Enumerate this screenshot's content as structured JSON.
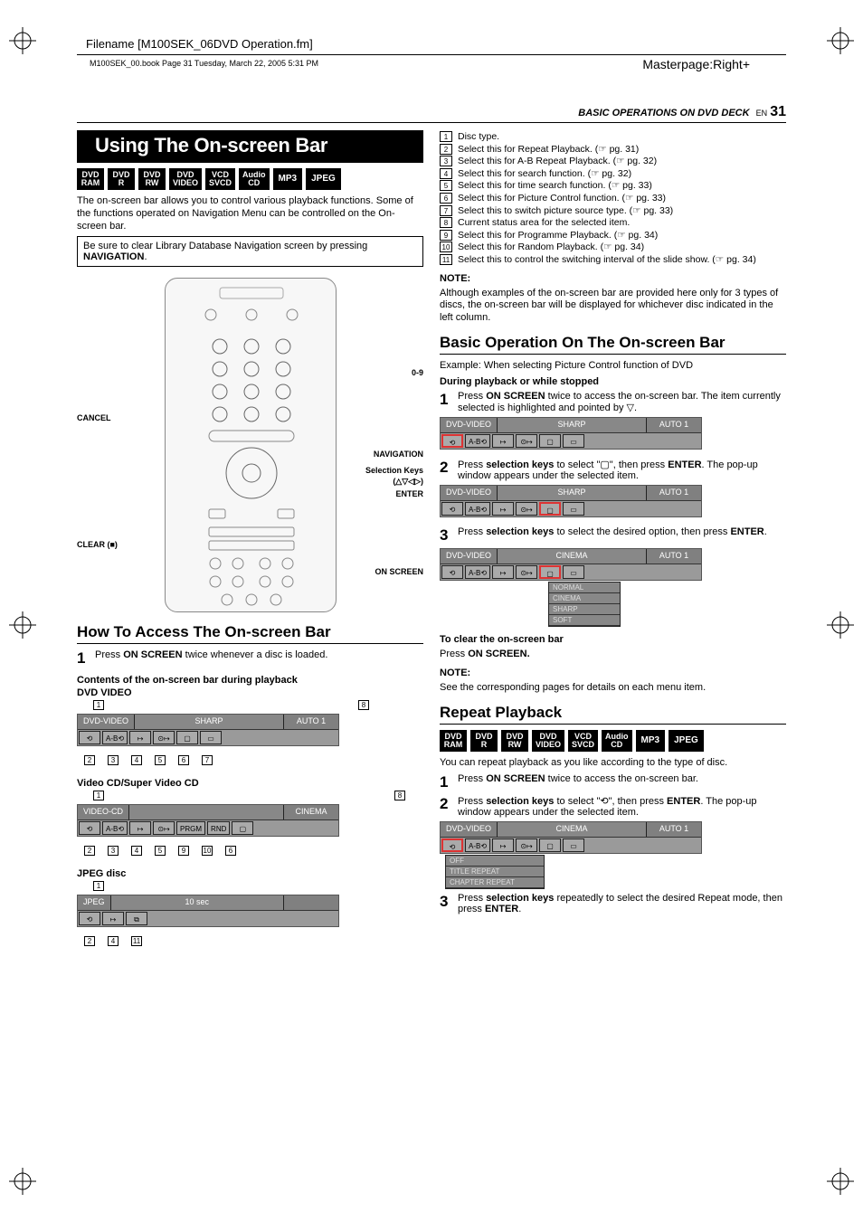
{
  "header": {
    "filename": "Filename [M100SEK_06DVD Operation.fm]",
    "bookline": "M100SEK_00.book  Page 31  Tuesday, March 22, 2005  5:31 PM",
    "masterpage": "Masterpage:Right+"
  },
  "running": {
    "title": "BASIC OPERATIONS ON DVD DECK",
    "lang": "EN",
    "page": "31"
  },
  "left": {
    "section_title": "Using The On-screen Bar",
    "badges": [
      "DVD RAM",
      "DVD R",
      "DVD RW",
      "DVD VIDEO",
      "VCD SVCD",
      "Audio CD",
      "MP3",
      "JPEG"
    ],
    "intro": "The on-screen bar allows you to control various playback functions. Some of the functions operated on Navigation Menu can be controlled on the On-screen bar.",
    "notebox_a": "Be sure to clear Library Database Navigation screen by pressing ",
    "notebox_b": "NAVIGATION",
    "notebox_c": ".",
    "remote_labels": {
      "numbers": "0-9",
      "cancel": "CANCEL",
      "navigation": "NAVIGATION",
      "selkeys": "Selection Keys",
      "selarrows": "(△▽◁▷)",
      "enter": "ENTER",
      "clear": "CLEAR (■)",
      "onscreen": "ON SCREEN"
    },
    "howto_title": "How To Access The On-screen Bar",
    "howto_step1_a": "Press ",
    "howto_step1_b": "ON SCREEN",
    "howto_step1_c": " twice whenever a disc is loaded.",
    "contents_title": "Contents of the on-screen bar during playback",
    "dvd_video_label": "DVD VIDEO",
    "vcd_label": "Video CD/Super Video CD",
    "jpeg_label": "JPEG disc",
    "osd_dvd": {
      "disc": "DVD-VIDEO",
      "mid": "SHARP",
      "right": "AUTO 1"
    },
    "osd_vcd": {
      "disc": "VIDEO-CD",
      "mid": "",
      "right": "CINEMA",
      "cells": [
        "PRGM",
        "RND"
      ]
    },
    "osd_jpeg": {
      "disc": "JPEG",
      "time": "10 sec"
    },
    "boxnums_dvd_top": [
      "1",
      "8"
    ],
    "boxnums_dvd_bot": [
      "2",
      "3",
      "4",
      "5",
      "6",
      "7"
    ],
    "boxnums_vcd_top": [
      "1",
      "8"
    ],
    "boxnums_vcd_bot": [
      "2",
      "3",
      "4",
      "5",
      "9",
      "10",
      "6"
    ],
    "boxnums_jpeg_top": [
      "1"
    ],
    "boxnums_jpeg_bot": [
      "2",
      "4",
      "11"
    ]
  },
  "right": {
    "callouts": [
      "Disc type.",
      "Select this for Repeat Playback. (☞ pg. 31)",
      "Select this for A-B Repeat Playback. (☞ pg. 32)",
      "Select this for search function. (☞ pg. 32)",
      "Select this for time search function. (☞ pg. 33)",
      "Select this for Picture Control function. (☞ pg. 33)",
      "Select this to switch picture source type. (☞ pg. 33)",
      "Current status area for the selected item.",
      "Select this for Programme Playback. (☞ pg. 34)",
      "Select this for Random Playback. (☞ pg. 34)",
      "Select this to control the switching interval of the slide show. (☞ pg. 34)"
    ],
    "note_label": "NOTE:",
    "note_text": "Although examples of the on-screen bar are provided here only for 3 types of discs, the on-screen bar will be displayed for whichever disc indicated in the left column.",
    "basic_title": "Basic Operation On The On-screen Bar",
    "basic_example": "Example: When selecting Picture Control function of DVD",
    "basic_during": "During playback or while stopped",
    "step1_a": "Press ",
    "step1_b": "ON SCREEN",
    "step1_c": " twice to access the on-screen bar. The item currently selected is highlighted and pointed by ▽.",
    "osd1": {
      "disc": "DVD-VIDEO",
      "mid": "SHARP",
      "right": "AUTO 1"
    },
    "step2_a": "Press ",
    "step2_b": "selection keys",
    "step2_c": " to select \"",
    "step2_d": "\", then press ",
    "step2_e": "ENTER",
    "step2_f": ". The pop-up window appears under the selected item.",
    "osd2": {
      "disc": "DVD-VIDEO",
      "mid": "SHARP",
      "right": "AUTO 1"
    },
    "step3_a": "Press ",
    "step3_b": "selection keys",
    "step3_c": " to select the desired option, then press ",
    "step3_d": "ENTER",
    "step3_e": ".",
    "osd3": {
      "disc": "DVD-VIDEO",
      "mid": "CINEMA",
      "right": "AUTO 1",
      "options": [
        "NORMAL",
        "CINEMA",
        "SHARP",
        "SOFT"
      ]
    },
    "clear_title": "To clear the on-screen bar",
    "clear_a": "Press ",
    "clear_b": "ON SCREEN.",
    "note2_label": "NOTE:",
    "note2_text": "See the corresponding pages for details on each menu item.",
    "repeat_title": "Repeat Playback",
    "repeat_badges": [
      "DVD RAM",
      "DVD R",
      "DVD RW",
      "DVD VIDEO",
      "VCD SVCD",
      "Audio CD",
      "MP3",
      "JPEG"
    ],
    "repeat_intro": "You can repeat playback as you like according to the type of disc.",
    "rstep1_a": "Press ",
    "rstep1_b": "ON SCREEN",
    "rstep1_c": " twice to access the on-screen bar.",
    "rstep2_a": "Press ",
    "rstep2_b": "selection keys",
    "rstep2_c": " to select \"⟲\", then press ",
    "rstep2_d": "ENTER",
    "rstep2_e": ". The pop-up window appears under the selected item.",
    "osd_r": {
      "disc": "DVD-VIDEO",
      "mid": "CINEMA",
      "right": "AUTO 1",
      "options": [
        "OFF",
        "TITLE REPEAT",
        "CHAPTER REPEAT"
      ]
    },
    "rstep3_a": "Press ",
    "rstep3_b": "selection keys",
    "rstep3_c": " repeatedly to select the desired Repeat mode, then press ",
    "rstep3_d": "ENTER",
    "rstep3_e": "."
  }
}
